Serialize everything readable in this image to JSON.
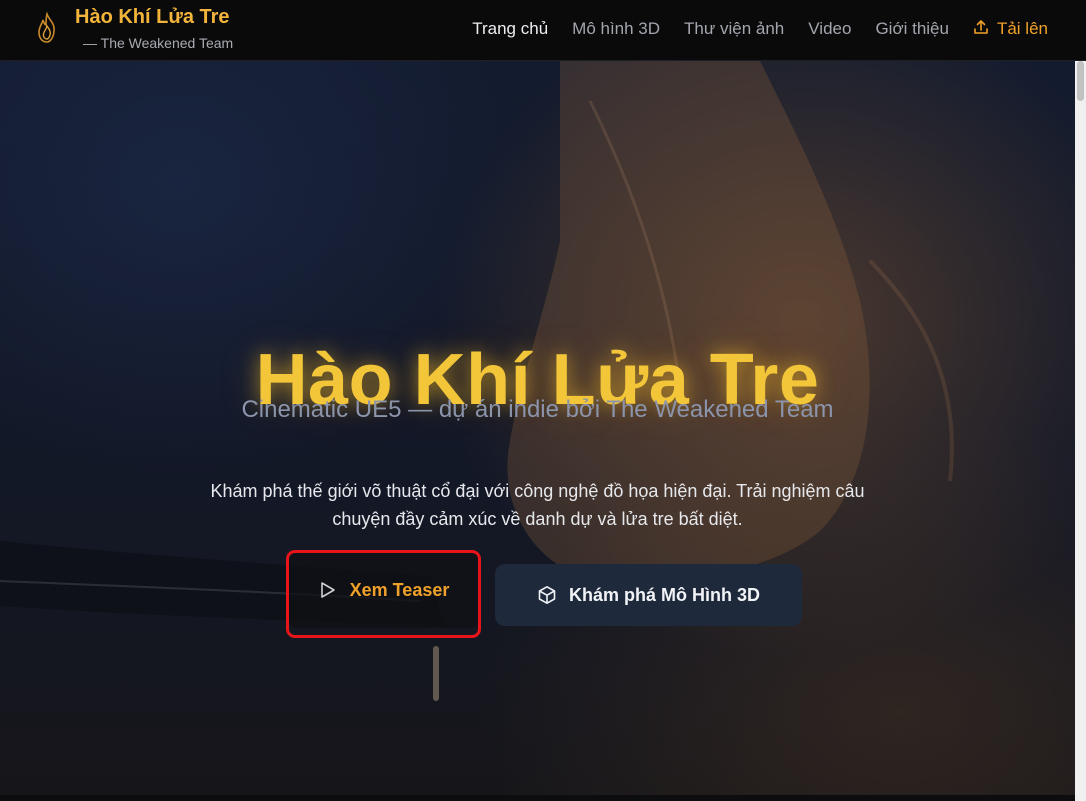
{
  "brand": {
    "title": "Hào Khí Lửa Tre",
    "subtitle": "— The Weakened Team",
    "logo_icon": "flame-logo-icon"
  },
  "nav": {
    "items": [
      {
        "label": "Trang chủ",
        "active": true
      },
      {
        "label": "Mô hình 3D",
        "active": false
      },
      {
        "label": "Thư viện ảnh",
        "active": false
      },
      {
        "label": "Video",
        "active": false
      },
      {
        "label": "Giới thiệu",
        "active": false
      }
    ],
    "upload": {
      "label": "Tải lên",
      "icon": "upload-icon"
    }
  },
  "hero": {
    "title": "Hào Khí Lửa Tre",
    "subtitle": "Cinematic UE5 — dự án indie bởi The Weakened Team",
    "description": "Khám phá thế giới võ thuật cổ đại với công nghệ đồ họa hiện đại. Trải nghiệm câu chuyện đầy cảm xúc về danh dự và lửa tre bất diệt.",
    "teaser_button": {
      "label": "Xem Teaser",
      "icon": "play-icon"
    },
    "model_button": {
      "label": "Khám phá Mô Hình 3D",
      "icon": "cube-icon"
    }
  },
  "colors": {
    "accent": "#f0a12a",
    "title_gold": "#f3c63a",
    "highlight_red": "#e8141a",
    "button_dark": "#1e293b"
  }
}
